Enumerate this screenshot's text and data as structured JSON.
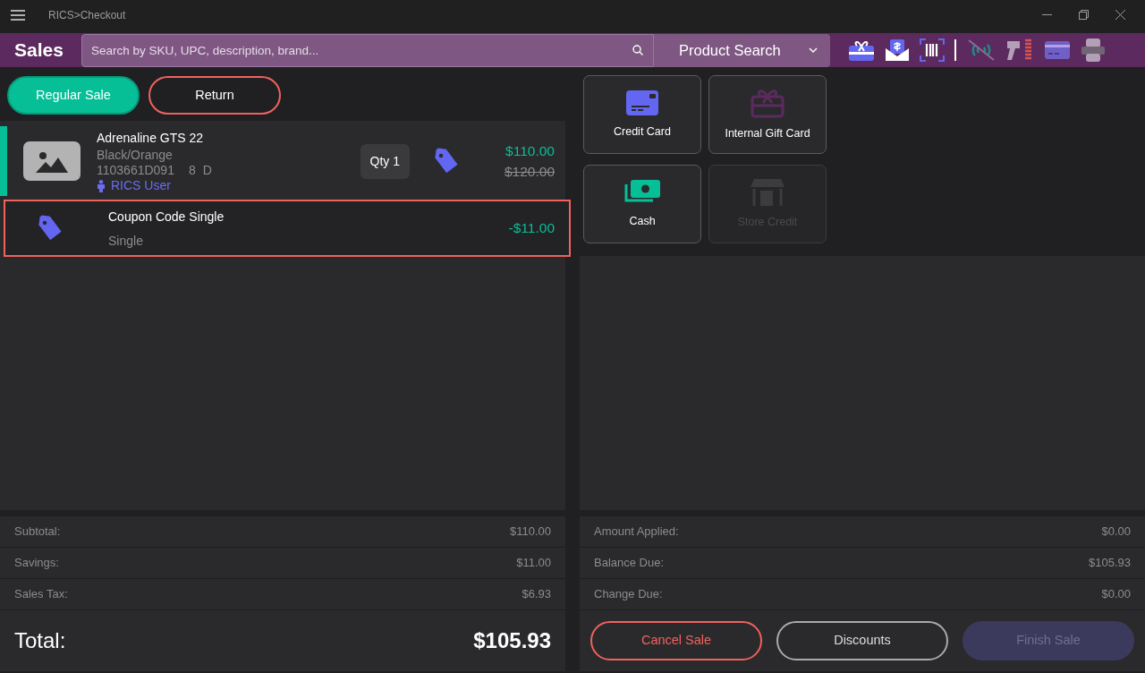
{
  "window": {
    "title": "RICS>Checkout"
  },
  "header": {
    "title": "Sales",
    "search": {
      "placeholder": "Search by SKU, UPC, description, brand..."
    },
    "search_mode": "Product Search"
  },
  "sale_types": [
    {
      "label": "Regular Sale",
      "selected": true
    },
    {
      "label": "Return",
      "selected": false
    }
  ],
  "line_items": [
    {
      "kind": "product",
      "name": "Adrenaline GTS 22",
      "colorway": "Black/Orange",
      "sku": "1103661D091",
      "size": "8",
      "width": "D",
      "associate": "RICS User",
      "qty": "Qty 1",
      "price": "$110.00",
      "original_price": "$120.00",
      "selected": false
    },
    {
      "kind": "coupon",
      "name": "Coupon Code Single",
      "detail": "Single",
      "amount": "-$11.00",
      "selected": true
    }
  ],
  "summary": [
    {
      "label": "Subtotal:",
      "value": "$110.00"
    },
    {
      "label": "Savings:",
      "value": "$11.00"
    },
    {
      "label": "Sales Tax:",
      "value": "$6.93"
    }
  ],
  "total": {
    "label": "Total:",
    "value": "$105.93"
  },
  "payment_methods": [
    {
      "kind": "credit",
      "label": "Credit Card",
      "disabled": false
    },
    {
      "kind": "gift",
      "label": "Internal Gift Card",
      "disabled": false
    },
    {
      "kind": "cash",
      "label": "Cash",
      "disabled": false
    },
    {
      "kind": "store",
      "label": "Store Credit",
      "disabled": true
    }
  ],
  "payment_summary": [
    {
      "label": "Amount Applied:",
      "value": "$0.00"
    },
    {
      "label": "Balance Due:",
      "value": "$105.93"
    },
    {
      "label": "Change Due:",
      "value": "$0.00"
    }
  ],
  "actions": [
    {
      "kind": "danger",
      "label": "Cancel Sale",
      "disabled": false
    },
    {
      "kind": "outline",
      "label": "Discounts",
      "disabled": false
    },
    {
      "kind": "primary",
      "label": "Finish Sale",
      "disabled": true
    }
  ]
}
